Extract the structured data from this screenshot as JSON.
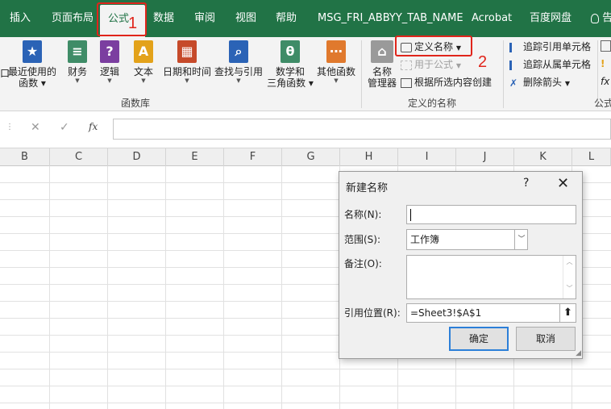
{
  "tabs": [
    "插入",
    "页面布局",
    "公式",
    "数据",
    "审阅",
    "视图",
    "帮助",
    "MSG_FRI_ABBYY_TAB_NAME",
    "Acrobat",
    "百度网盘",
    "告"
  ],
  "annotations": {
    "one": "1",
    "two": "2"
  },
  "ribbon": {
    "function_library": {
      "buttons": [
        {
          "label": "最近使用的\n函数",
          "icon": "star-icon",
          "color": "#2b63b6"
        },
        {
          "label": "财务",
          "icon": "coins-icon",
          "color": "#3f8c67"
        },
        {
          "label": "逻辑",
          "icon": "question-icon",
          "color": "#7b3ea0"
        },
        {
          "label": "文本",
          "icon": "text-a-icon",
          "color": "#e3a21a"
        },
        {
          "label": "日期和时间",
          "icon": "calendar-icon",
          "color": "#c64a2a"
        },
        {
          "label": "查找与引用",
          "icon": "magnifier-icon",
          "color": "#2b63b6"
        },
        {
          "label": "数学和\n三角函数",
          "icon": "theta-icon",
          "color": "#3f8c67"
        },
        {
          "label": "其他函数",
          "icon": "more-icon",
          "color": "#e0792d"
        }
      ],
      "group_label": "函数库"
    },
    "defined_names": {
      "name_manager": "名称\n管理器",
      "define_name": "定义名称",
      "use_in_formula": "用于公式",
      "create_from_selection": "根据所选内容创建",
      "group_label": "定义的名称"
    },
    "formula_auditing": {
      "trace_precedents": "追踪引用单元格",
      "trace_dependents": "追踪从属单元格",
      "remove_arrows": "删除箭头",
      "group_label": "公式"
    }
  },
  "formula_bar": {
    "cancel": "✕",
    "enter": "✓",
    "fx": "fx",
    "value": ""
  },
  "columns": [
    "B",
    "C",
    "D",
    "E",
    "F",
    "G",
    "H",
    "I",
    "J",
    "K",
    "L"
  ],
  "dialog": {
    "title": "新建名称",
    "help": "?",
    "close": "✕",
    "name_label": "名称(N):",
    "name_value": "",
    "scope_label": "范围(S):",
    "scope_value": "工作簿",
    "comment_label": "备注(O):",
    "comment_value": "",
    "refers_to_label": "引用位置(R):",
    "refers_to_value": "=Sheet3!$A$1",
    "ok": "确定",
    "cancel": "取消"
  },
  "colors": {
    "excel_green": "#217346",
    "annotation_red": "#e0251b",
    "focus_blue": "#2c7fd8"
  }
}
